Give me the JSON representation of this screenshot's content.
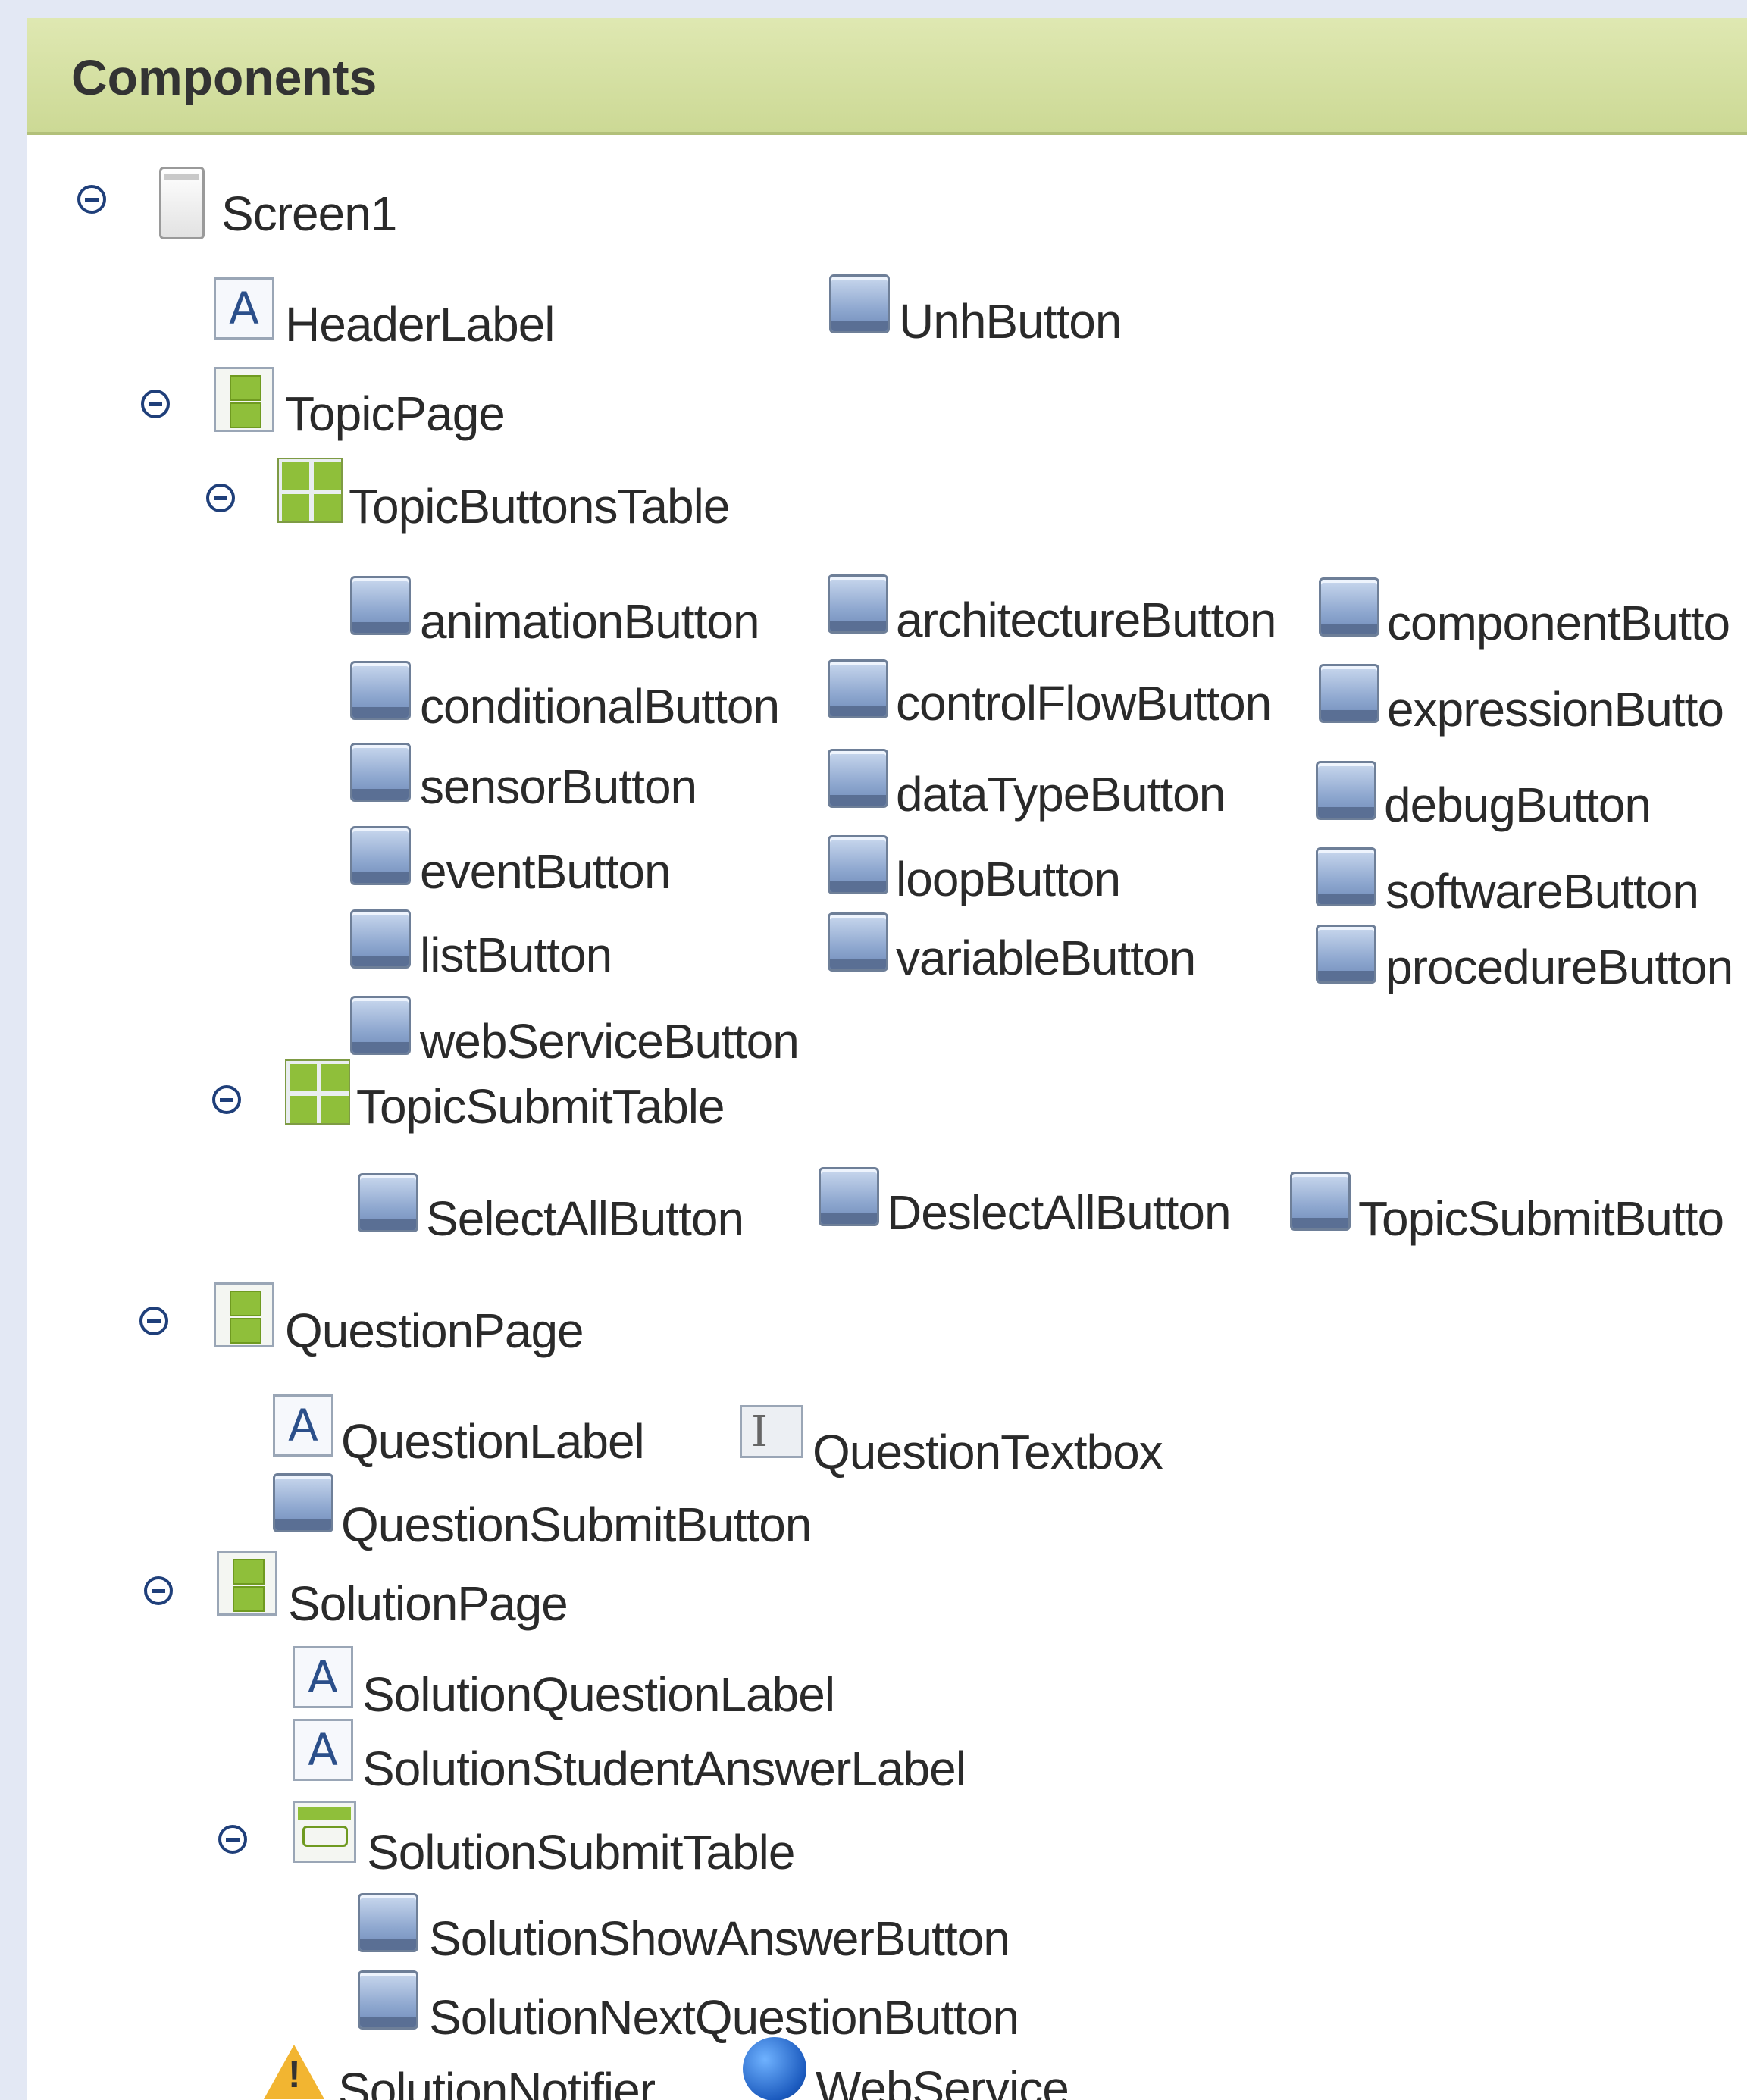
{
  "panel": {
    "title": "Components"
  },
  "tree": {
    "screen": "Screen1",
    "header_label": "HeaderLabel",
    "unh_button": "UnhButton",
    "topic_page": {
      "name": "TopicPage",
      "buttons_table": {
        "name": "TopicButtonsTable",
        "columns": [
          [
            "animationButton",
            "conditionalButton",
            "sensorButton",
            "eventButton",
            "listButton",
            "webServiceButton"
          ],
          [
            "architectureButton",
            "controlFlowButton",
            "dataTypeButton",
            "loopButton",
            "variableButton"
          ],
          [
            "componentButto",
            "expressionButto",
            "debugButton",
            "softwareButton",
            "procedureButton"
          ]
        ]
      },
      "submit_table": {
        "name": "TopicSubmitTable",
        "items": [
          "SelectAllButton",
          "DeslectAllButton",
          "TopicSubmitButto"
        ]
      }
    },
    "question_page": {
      "name": "QuestionPage",
      "label": "QuestionLabel",
      "textbox": "QuestionTextbox",
      "submit": "QuestionSubmitButton"
    },
    "solution_page": {
      "name": "SolutionPage",
      "question_label": "SolutionQuestionLabel",
      "student_answer_label": "SolutionStudentAnswerLabel",
      "submit_table": {
        "name": "SolutionSubmitTable",
        "items": [
          "SolutionShowAnswerButton",
          "SolutionNextQuestionButton"
        ]
      },
      "notifier": "SolutionNotifier",
      "web_service": "WebService"
    }
  },
  "icons": {
    "collapse": "collapse-icon",
    "screen": "screen-icon",
    "label": "label-icon",
    "button": "button-icon",
    "textbox": "textbox-icon",
    "vertical_arrangement": "vertical-arrangement-icon",
    "table_arrangement": "table-arrangement-icon",
    "horizontal_arrangement": "horizontal-arrangement-icon",
    "notifier": "warning-icon",
    "web": "globe-icon"
  },
  "colors": {
    "header_bg": "#d6e1a3",
    "toggle": "#1f3f7a",
    "text": "#2a2a2a"
  }
}
